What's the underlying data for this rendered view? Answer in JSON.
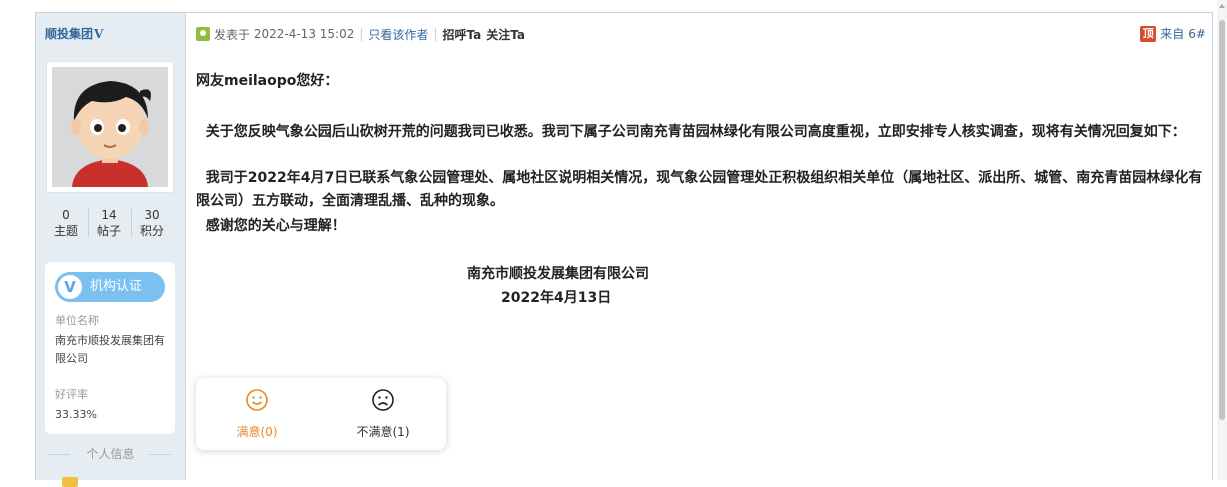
{
  "author": {
    "name": "顺投集团",
    "verify_mark": "V"
  },
  "stats": [
    {
      "value": "0",
      "label": "主题"
    },
    {
      "value": "14",
      "label": "帖子"
    },
    {
      "value": "30",
      "label": "积分"
    }
  ],
  "cert": {
    "badge_mark": "V",
    "badge": "机构认证",
    "unit_label": "单位名称",
    "unit_name": "南充市顺投发展集团有限公司",
    "rate_label": "好评率",
    "rate": "33.33%"
  },
  "section": {
    "title": "个人信息"
  },
  "post": {
    "posted_prefix": "发表于",
    "posted_time": "2022-4-13 15:02",
    "only_author": "只看该作者",
    "greet_action": "招呼Ta",
    "follow_action": "关注Ta",
    "top_badge": "顶",
    "floor_prefix": "来自",
    "floor": "6#"
  },
  "content": {
    "greeting": "网友meilaopo您好：",
    "para1": "关于您反映气象公园后山砍树开荒的问题我司已收悉。我司下属子公司南充青苗园林绿化有限公司高度重视，立即安排专人核实调查，现将有关情况回复如下：",
    "para2": "我司于2022年4月7日已联系气象公园管理处、属地社区说明相关情况，现气象公园管理处正积极组织相关单位（属地社区、派出所、城管、南充青苗园林绿化有限公司）五方联动，全面清理乱播、乱种的现象。",
    "para3": "感谢您的关心与理解！",
    "sign_org": "南充市顺投发展集团有限公司",
    "sign_date": "2022年4月13日"
  },
  "rating": {
    "satisfied": "满意(0)",
    "unsatisfied": "不满意(1)",
    "satisfied_color": "#e88a2a"
  },
  "colors": {
    "link": "#336699",
    "sidebar_bg": "#e5edf2",
    "accent_badge": "#7cc0f0"
  }
}
